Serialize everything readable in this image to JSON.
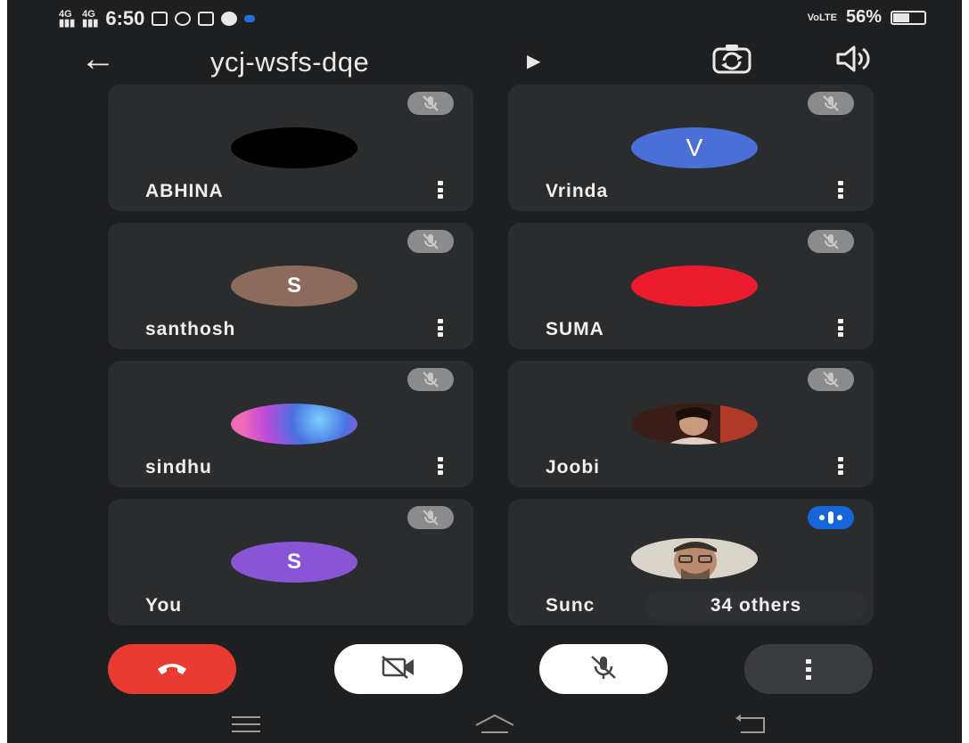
{
  "status_bar": {
    "network_left": "4G",
    "network_left2": "4G",
    "time": "6:50",
    "right_network": "VoLTE",
    "battery": "56%",
    "battery_level": 0.56
  },
  "header": {
    "meeting_code": "ycj-wsfs-dqe",
    "back_icon": "arrow-left-icon",
    "switch_camera_icon": "camera-flip-icon",
    "audio_icon": "speaker-icon"
  },
  "participants": [
    {
      "name": "ABHINA",
      "avatar_color": "#000000",
      "initial": "",
      "status": "muted"
    },
    {
      "name": "Vrinda",
      "avatar_color": "#4a6fd6",
      "initial": "V",
      "status": "muted"
    },
    {
      "name": "santhosh",
      "avatar_color": "#8c6a5c",
      "initial": "S",
      "status": "muted"
    },
    {
      "name": "SUMA",
      "avatar_color": "#ec1c2f",
      "initial": "",
      "status": "muted"
    },
    {
      "name": "sindhu",
      "avatar_color": "photo",
      "initial": "",
      "status": "muted"
    },
    {
      "name": "Joobi",
      "avatar_color": "photo",
      "initial": "",
      "status": "muted"
    },
    {
      "name": "You",
      "avatar_color": "#8a54d6",
      "initial": "S",
      "status": "muted"
    },
    {
      "name": "Sunc",
      "avatar_color": "photo",
      "initial": "",
      "status": "speaking"
    }
  ],
  "others_badge": "34 others",
  "controls": {
    "end_call": "phone-hangup-icon",
    "camera": "camera-off-icon",
    "mic": "mic-off-icon",
    "more": "more-vertical-icon"
  },
  "colors": {
    "end_call": "#ea3b32",
    "speaking_badge": "#1565d8",
    "tile_bg": "#2b2c2e"
  }
}
